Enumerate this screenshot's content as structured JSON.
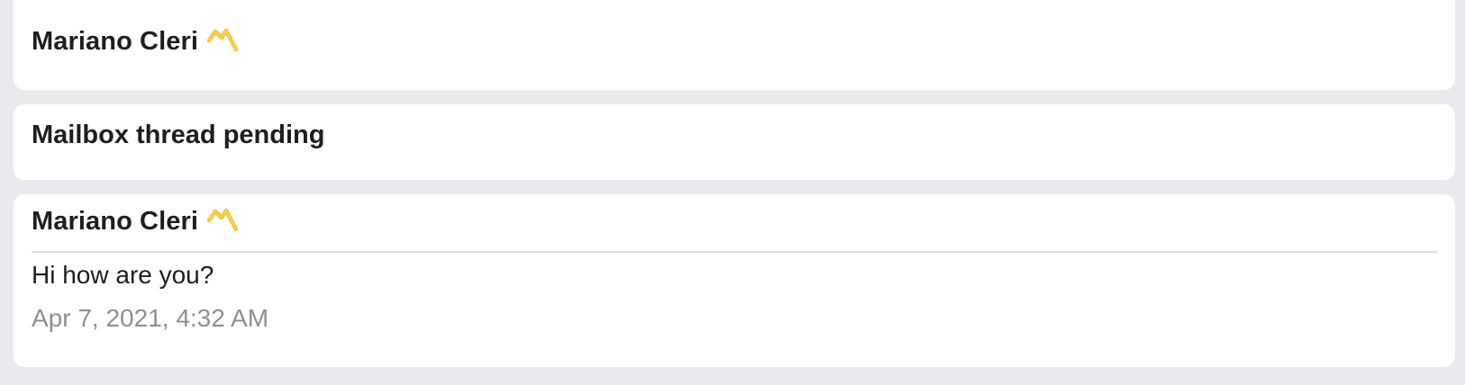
{
  "header_card": {
    "sender_name": "Mariano Cleri",
    "badge_icon": "crown-badge-icon"
  },
  "status_card": {
    "title": "Mailbox thread pending"
  },
  "message_card": {
    "sender_name": "Mariano Cleri",
    "badge_icon": "crown-badge-icon",
    "text": "Hi how are you?",
    "timestamp": "Apr 7, 2021, 4:32 AM"
  },
  "colors": {
    "background": "#e9eaee",
    "card": "#ffffff",
    "text_primary": "#1c1e21",
    "text_secondary": "#8b9097",
    "badge": "#f2c230"
  }
}
